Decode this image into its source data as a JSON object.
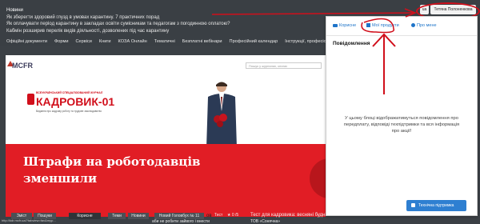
{
  "news": {
    "header": "Новини",
    "lines": [
      "Як зберегти здоровий глузд в умовах карантину. 7 практичних порад",
      "Як оплачувати період карантину в закладах освіти сумісникам та педагогам з погодинною оплатою?",
      "Кабмін розширив перелік видів діяльності, дозволених під час карантину"
    ]
  },
  "nav": [
    "Офіційні документи",
    "Форми",
    "Сервіси",
    "Книги",
    "КОЗА Онлайн",
    "Тематичні",
    "Безплатні вебінари",
    "Професійний календар",
    "Інструкції, професіограми"
  ],
  "user": {
    "mini_label": "ua",
    "name": "Тетяна Полоненкова"
  },
  "content": {
    "brand": "MCFR",
    "search_placeholder": "Пошук у журналах, книгах",
    "journal_small": "ВСЕУКРАЇНСЬКИЙ СПЕЦІАЛІЗОВАНИЙ ЖУРНАЛ",
    "journal_title": "КАДРОВИК-01",
    "journal_sub": "Видання про кадрову роботу та трудове законодавство",
    "banner_title": "Штрафи на роботодавців зменшили"
  },
  "panel": {
    "tabs": {
      "favorites": "Корисне",
      "products": "Мої продукти",
      "about": "Про мене"
    },
    "heading": "Повідомлення",
    "message": "У цьому блоці відображатимуться повідомлення про передплату, відповіді техпідтримки та вся інформація про акції!",
    "support_button": "Технічна підтримка"
  },
  "bottom": {
    "status_url": "http://kdr.mcfr.ua/?tabview=fav&myp...",
    "btn_contents": "Зміст",
    "btn_search": "Пошуки",
    "btn_useful": "Корисне",
    "btn_themes": "Теми",
    "btn_news": "Новини",
    "issue": "Новий Головбух № 11",
    "rate_label": "Тест",
    "rate_value": "0 /5",
    "headline_left": "ов",
    "sub_left": "аби не робити зайвого і внести",
    "headline_right": "Тест для кадровика: весняні будні",
    "sub_right": "ТОВ «Сонячна»"
  }
}
